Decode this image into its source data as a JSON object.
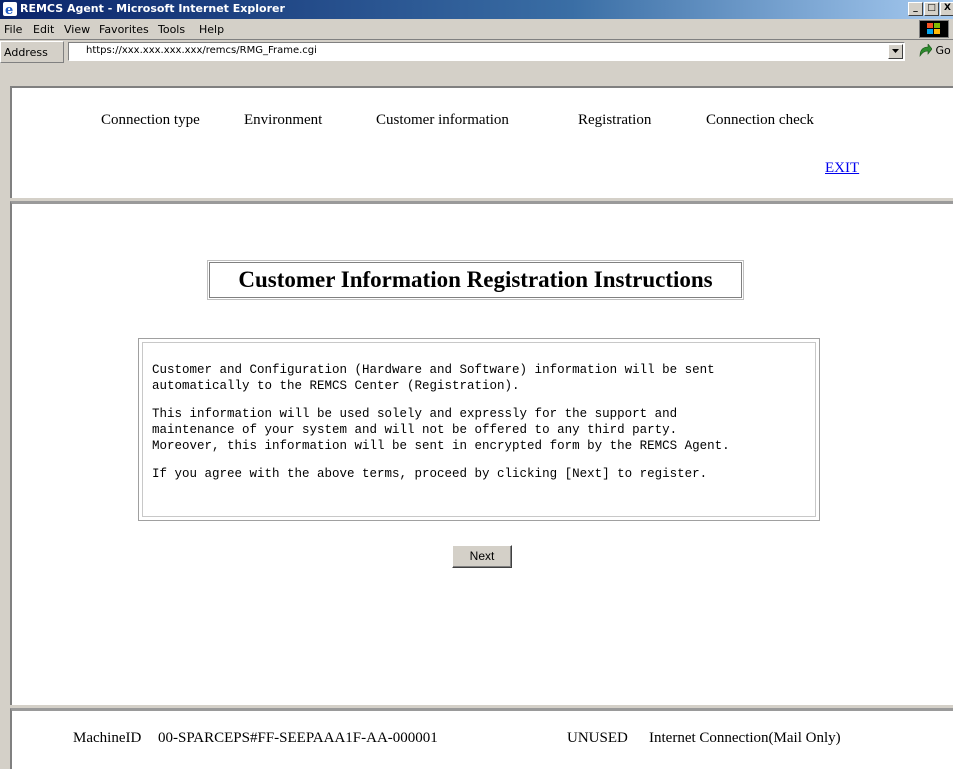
{
  "window": {
    "title": "REMCS Agent - Microsoft Internet Explorer",
    "controls": [
      "_",
      "□",
      "X"
    ]
  },
  "menubar": {
    "items": [
      {
        "label": "File"
      },
      {
        "label": "Edit"
      },
      {
        "label": "View"
      },
      {
        "label": "Favorites"
      },
      {
        "label": "Tools"
      },
      {
        "label": "Help"
      }
    ]
  },
  "addressbar": {
    "label": "Address",
    "url": "https://xxx.xxx.xxx.xxx/remcs/RMG_Frame.cgi",
    "go_label": "Go"
  },
  "steps": [
    {
      "label": "Connection type"
    },
    {
      "label": "Environment"
    },
    {
      "label": "Customer information"
    },
    {
      "label": "Registration"
    },
    {
      "label": "Connection check"
    }
  ],
  "exit_label": "EXIT",
  "main": {
    "heading": "Customer Information Registration Instructions",
    "paragraphs": [
      "Customer and Configuration (Hardware and Software) information will be sent\nautomatically to the REMCS Center (Registration).",
      "This information will be used solely and expressly for the support and\nmaintenance of your system and will not be offered to any third party.\nMoreover, this information will be sent in encrypted form by the REMCS Agent.",
      "If you agree with the above terms, proceed by clicking [Next] to register."
    ],
    "next_label": "Next"
  },
  "status": {
    "machine_label": "MachineID",
    "machine_id": "00-SPARCEPS#FF-SEEPAAA1F-AA-000001",
    "state": "UNUSED",
    "connection": "Internet Connection(Mail Only)"
  },
  "colors": {
    "link": "#0000ee",
    "titlebar_start": "#0a246a",
    "chrome": "#d4d0c8"
  }
}
